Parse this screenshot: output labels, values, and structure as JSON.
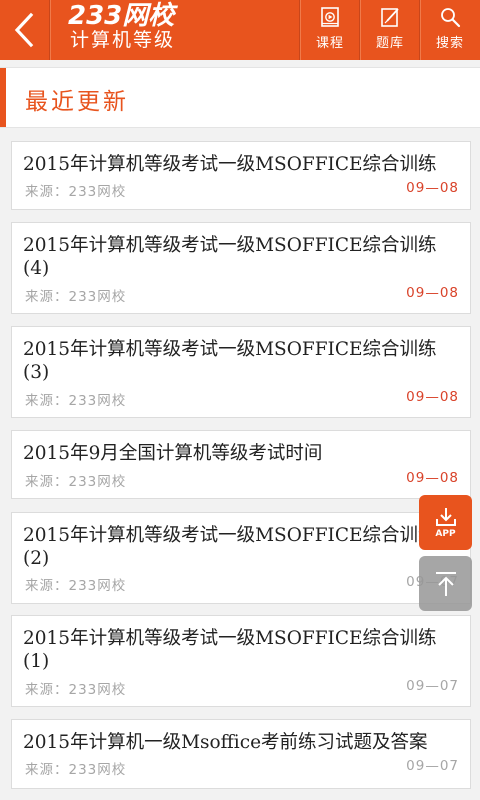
{
  "header": {
    "logo_main": "233网校",
    "logo_sub": "计算机等级",
    "nav": [
      {
        "label": "课程",
        "icon": "course-icon"
      },
      {
        "label": "题库",
        "icon": "question-bank-icon"
      },
      {
        "label": "搜索",
        "icon": "search-icon"
      }
    ]
  },
  "section": {
    "title": "最近更新"
  },
  "articles": [
    {
      "title": "2015年计算机等级考试一级MSOFFICE综合训练",
      "source": "来源：233网校",
      "date": "09—08"
    },
    {
      "title": "2015年计算机等级考试一级MSOFFICE综合训练(4)",
      "source": "来源：233网校",
      "date": "09—08"
    },
    {
      "title": "2015年计算机等级考试一级MSOFFICE综合训练(3)",
      "source": "来源：233网校",
      "date": "09—08"
    },
    {
      "title": "2015年9月全国计算机等级考试时间",
      "source": "来源：233网校",
      "date": "09—08"
    },
    {
      "title": "2015年计算机等级考试一级MSOFFICE综合训练(2)",
      "source": "来源：233网校",
      "date": "09—07"
    },
    {
      "title": "2015年计算机等级考试一级MSOFFICE综合训练(1)",
      "source": "来源：233网校",
      "date": "09—07"
    },
    {
      "title": "2015年计算机一级Msoffice考前练习试题及答案",
      "source": "来源：233网校",
      "date": "09—07"
    }
  ],
  "fab": {
    "app_label": "APP"
  },
  "colors": {
    "brand": "#e8541e",
    "date_recent": "#d9432a",
    "date_old": "#a6a6a6"
  }
}
